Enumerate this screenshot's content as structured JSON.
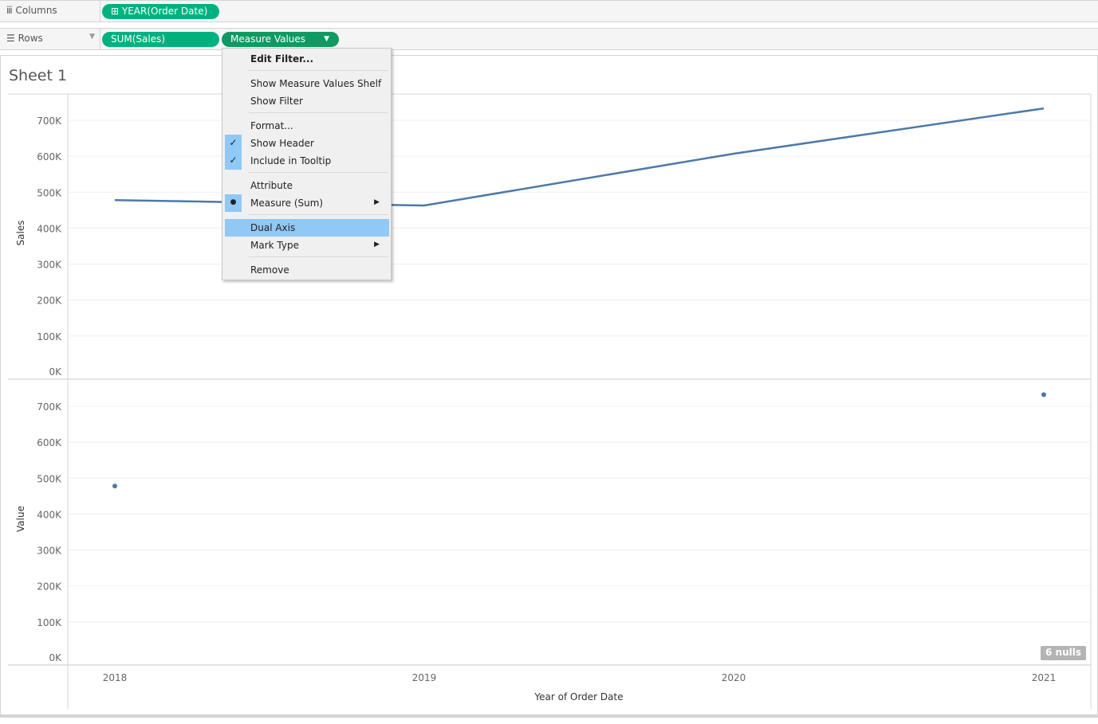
{
  "shelves": {
    "columns_label": "Columns",
    "rows_label": "Rows",
    "columns_pill": "⊞ YEAR(Order Date)",
    "rows_pills": [
      "SUM(Sales)",
      "Measure Values"
    ]
  },
  "sheet_title": "Sheet 1",
  "context_menu": {
    "items": [
      "Edit Filter...",
      "Show Measure Values Shelf",
      "Show Filter",
      "Format...",
      "Show Header",
      "Include in Tooltip",
      "Attribute",
      "Measure (Sum)",
      "Dual Axis",
      "Mark Type",
      "Remove"
    ],
    "checked": [
      "Show Header",
      "Include in Tooltip"
    ],
    "radio_selected": "Measure (Sum)",
    "highlighted": "Dual Axis"
  },
  "nulls_badge": "6 nulls",
  "chart_data": [
    {
      "type": "line",
      "ylabel": "Sales",
      "x": [
        "2018",
        "2019",
        "2020",
        "2021"
      ],
      "values": [
        478,
        463,
        607,
        733
      ],
      "unit": "K",
      "ylim": [
        0,
        760
      ],
      "yticks": [
        "0K",
        "100K",
        "200K",
        "300K",
        "400K",
        "500K",
        "600K",
        "700K"
      ]
    },
    {
      "type": "scatter",
      "ylabel": "Value",
      "x": [
        "2018",
        "2021"
      ],
      "values": [
        478,
        732
      ],
      "unit": "K",
      "ylim": [
        0,
        760
      ],
      "yticks": [
        "0K",
        "100K",
        "200K",
        "300K",
        "400K",
        "500K",
        "600K",
        "700K"
      ]
    }
  ],
  "xaxis": {
    "title": "Year of Order Date",
    "ticks": [
      "2018",
      "2019",
      "2020",
      "2021"
    ]
  },
  "colors": {
    "line": "#4e79a7",
    "pill": "#00b180"
  }
}
